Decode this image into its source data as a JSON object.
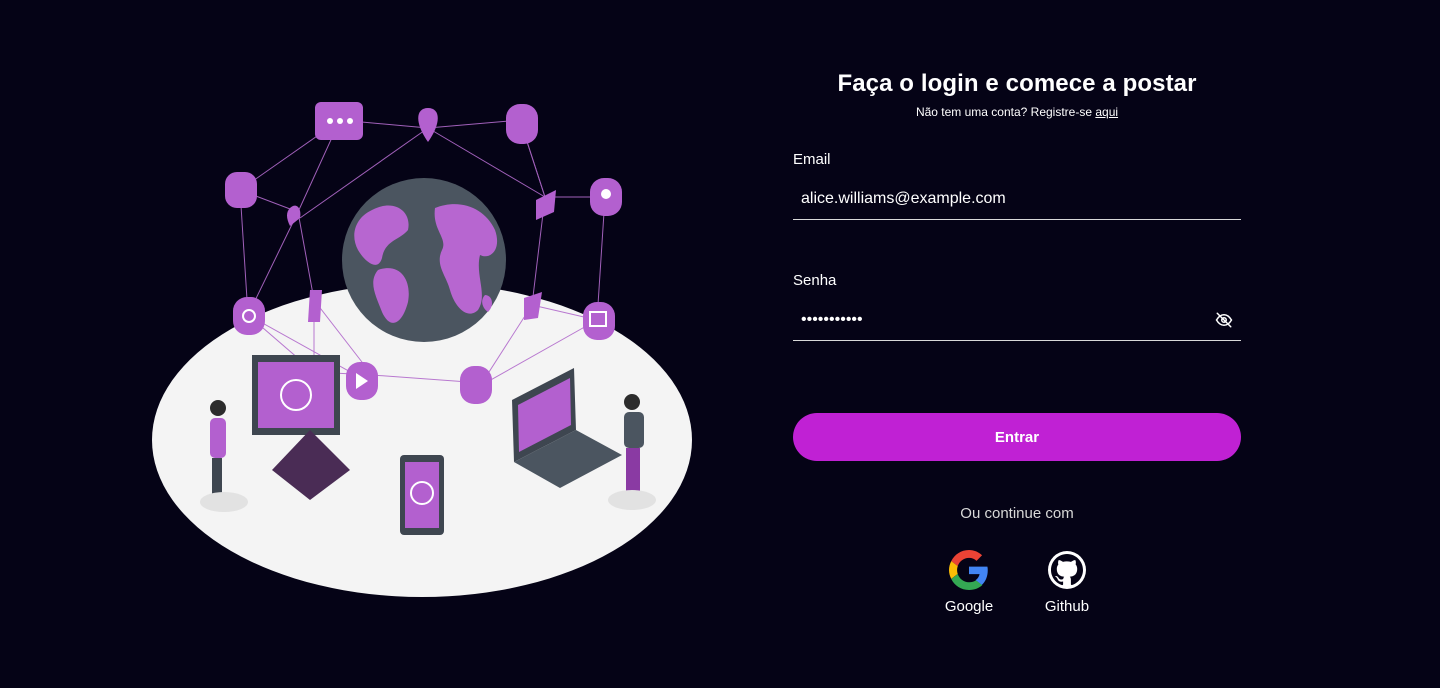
{
  "form": {
    "title": "Faça o login e comece a postar",
    "subtitle_text": "Não tem uma conta? Registre-se ",
    "register_link": "aqui",
    "email_label": "Email",
    "email_value": "alice.williams@example.com",
    "password_label": "Senha",
    "password_value": "•••••••••••",
    "submit_label": "Entrar",
    "or_text": "Ou continue com"
  },
  "social": [
    {
      "label": "Google",
      "icon": "google-icon"
    },
    {
      "label": "Github",
      "icon": "github-icon"
    }
  ],
  "colors": {
    "background": "#050316",
    "accent": "#c021d4",
    "illustration_purple": "#a855c8",
    "platform": "#f4f4f4"
  }
}
